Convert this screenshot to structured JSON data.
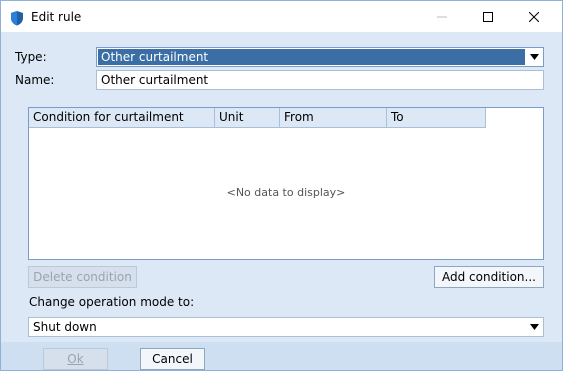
{
  "window": {
    "title": "Edit rule",
    "accent_color": "#3a6ea5"
  },
  "form": {
    "type_label": "Type:",
    "type_value": "Other curtailment",
    "name_label": "Name:",
    "name_value": "Other curtailment"
  },
  "grid": {
    "columns": [
      "Condition for curtailment",
      "Unit",
      "From",
      "To"
    ],
    "empty_text": "<No data to display>"
  },
  "buttons": {
    "delete_condition": "Delete condition",
    "add_condition": "Add condition...",
    "ok": "Ok",
    "cancel": "Cancel"
  },
  "mode": {
    "label": "Change operation mode to:",
    "value": "Shut down"
  },
  "icons": {
    "app": "shield-app-icon",
    "minimize": "minimize-icon",
    "maximize": "maximize-icon",
    "close": "close-icon",
    "dropdown": "chevron-down-icon"
  }
}
